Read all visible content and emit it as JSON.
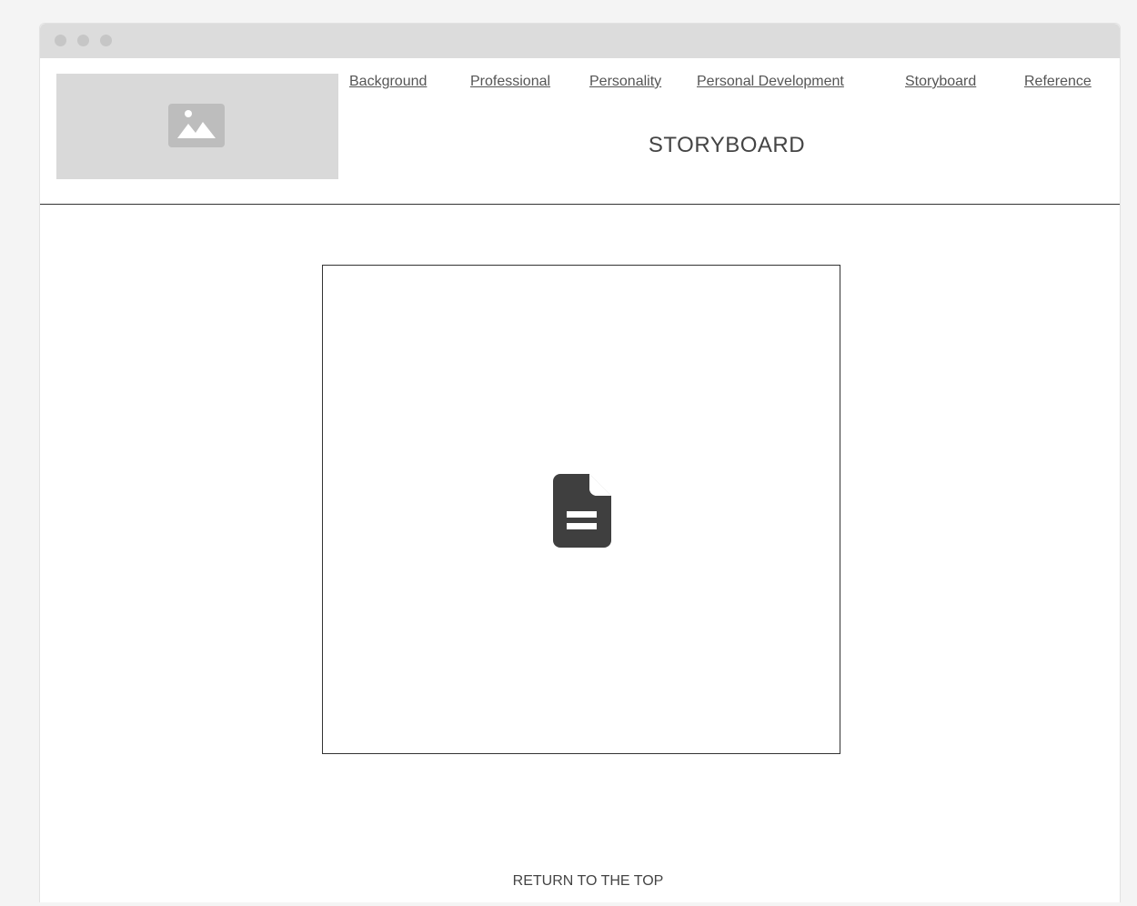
{
  "nav": {
    "links": [
      {
        "label": "Background"
      },
      {
        "label": "Professional"
      },
      {
        "label": "Personality"
      },
      {
        "label": "Personal Development"
      },
      {
        "label": "Storyboard"
      },
      {
        "label": "Reference"
      }
    ]
  },
  "header": {
    "title": "STORYBOARD"
  },
  "logo": {
    "icon": "image-placeholder-icon"
  },
  "content": {
    "icon": "document-icon"
  },
  "footer": {
    "return_label": "RETURN TO THE TOP"
  },
  "colors": {
    "background": "#f4f4f4",
    "window": "#ffffff",
    "titlebar": "#dcdcdc",
    "placeholder": "#d9d9d9",
    "text": "#555555",
    "icon": "#3f3f3f"
  }
}
